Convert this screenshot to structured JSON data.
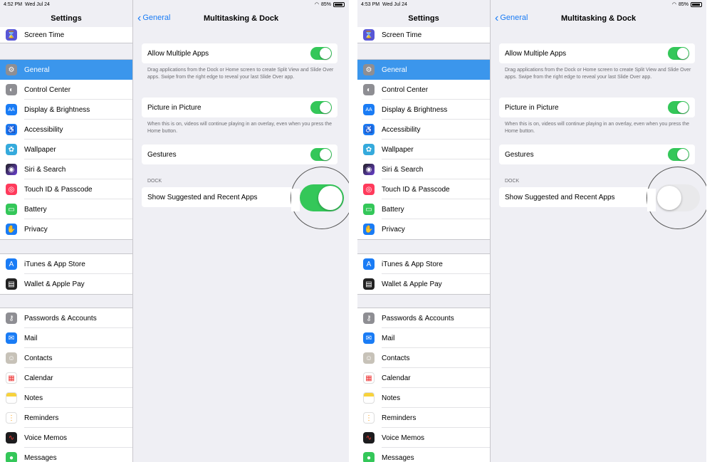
{
  "panels": [
    {
      "status": {
        "time": "4:52 PM",
        "date": "Wed Jul 24",
        "battery": "85%"
      },
      "settings_title": "Settings",
      "top_item": {
        "label": "Screen Time",
        "icon": "hourglass-icon"
      },
      "group1": [
        {
          "label": "General",
          "icon": "gear-icon",
          "selected": true
        },
        {
          "label": "Control Center",
          "icon": "switches-icon"
        },
        {
          "label": "Display & Brightness",
          "icon": "text-size-icon"
        },
        {
          "label": "Accessibility",
          "icon": "accessibility-icon"
        },
        {
          "label": "Wallpaper",
          "icon": "flower-icon"
        },
        {
          "label": "Siri & Search",
          "icon": "siri-icon"
        },
        {
          "label": "Touch ID & Passcode",
          "icon": "fingerprint-icon"
        },
        {
          "label": "Battery",
          "icon": "battery-icon"
        },
        {
          "label": "Privacy",
          "icon": "hand-icon"
        }
      ],
      "group2": [
        {
          "label": "iTunes & App Store",
          "icon": "app-store-icon"
        },
        {
          "label": "Wallet & Apple Pay",
          "icon": "wallet-icon"
        }
      ],
      "group3": [
        {
          "label": "Passwords & Accounts",
          "icon": "key-icon"
        },
        {
          "label": "Mail",
          "icon": "mail-icon"
        },
        {
          "label": "Contacts",
          "icon": "contacts-icon"
        },
        {
          "label": "Calendar",
          "icon": "calendar-icon"
        },
        {
          "label": "Notes",
          "icon": "notes-icon"
        },
        {
          "label": "Reminders",
          "icon": "reminders-icon"
        },
        {
          "label": "Voice Memos",
          "icon": "voice-memos-icon"
        },
        {
          "label": "Messages",
          "icon": "messages-icon"
        }
      ],
      "nav": {
        "back": "General",
        "title": "Multitasking & Dock"
      },
      "allow_multiple_apps": {
        "label": "Allow Multiple Apps",
        "on": true
      },
      "allow_desc": "Drag applications from the Dock or Home screen to create Split View and Slide Over apps. Swipe from the right edge to reveal your last Slide Over app.",
      "pip": {
        "label": "Picture in Picture",
        "on": true
      },
      "pip_desc": "When this is on, videos will continue playing in an overlay, even when you press the Home button.",
      "gestures": {
        "label": "Gestures",
        "on": true
      },
      "dock_header": "DOCK",
      "suggested": {
        "label": "Show Suggested and Recent Apps",
        "on": true
      }
    },
    {
      "status": {
        "time": "4:53 PM",
        "date": "Wed Jul 24",
        "battery": "85%"
      },
      "settings_title": "Settings",
      "top_item": {
        "label": "Screen Time",
        "icon": "hourglass-icon"
      },
      "group1": [
        {
          "label": "General",
          "icon": "gear-icon",
          "selected": true
        },
        {
          "label": "Control Center",
          "icon": "switches-icon"
        },
        {
          "label": "Display & Brightness",
          "icon": "text-size-icon"
        },
        {
          "label": "Accessibility",
          "icon": "accessibility-icon"
        },
        {
          "label": "Wallpaper",
          "icon": "flower-icon"
        },
        {
          "label": "Siri & Search",
          "icon": "siri-icon"
        },
        {
          "label": "Touch ID & Passcode",
          "icon": "fingerprint-icon"
        },
        {
          "label": "Battery",
          "icon": "battery-icon"
        },
        {
          "label": "Privacy",
          "icon": "hand-icon"
        }
      ],
      "group2": [
        {
          "label": "iTunes & App Store",
          "icon": "app-store-icon"
        },
        {
          "label": "Wallet & Apple Pay",
          "icon": "wallet-icon"
        }
      ],
      "group3": [
        {
          "label": "Passwords & Accounts",
          "icon": "key-icon"
        },
        {
          "label": "Mail",
          "icon": "mail-icon"
        },
        {
          "label": "Contacts",
          "icon": "contacts-icon"
        },
        {
          "label": "Calendar",
          "icon": "calendar-icon"
        },
        {
          "label": "Notes",
          "icon": "notes-icon"
        },
        {
          "label": "Reminders",
          "icon": "reminders-icon"
        },
        {
          "label": "Voice Memos",
          "icon": "voice-memos-icon"
        },
        {
          "label": "Messages",
          "icon": "messages-icon"
        }
      ],
      "nav": {
        "back": "General",
        "title": "Multitasking & Dock"
      },
      "allow_multiple_apps": {
        "label": "Allow Multiple Apps",
        "on": true
      },
      "allow_desc": "Drag applications from the Dock or Home screen to create Split View and Slide Over apps. Swipe from the right edge to reveal your last Slide Over app.",
      "pip": {
        "label": "Picture in Picture",
        "on": true
      },
      "pip_desc": "When this is on, videos will continue playing in an overlay, even when you press the Home button.",
      "gestures": {
        "label": "Gestures",
        "on": true
      },
      "dock_header": "DOCK",
      "suggested": {
        "label": "Show Suggested and Recent Apps",
        "on": false
      }
    }
  ],
  "colors": {
    "selected": "#3b96ec",
    "toggle_on": "#34c759",
    "link": "#1a7cf5"
  }
}
